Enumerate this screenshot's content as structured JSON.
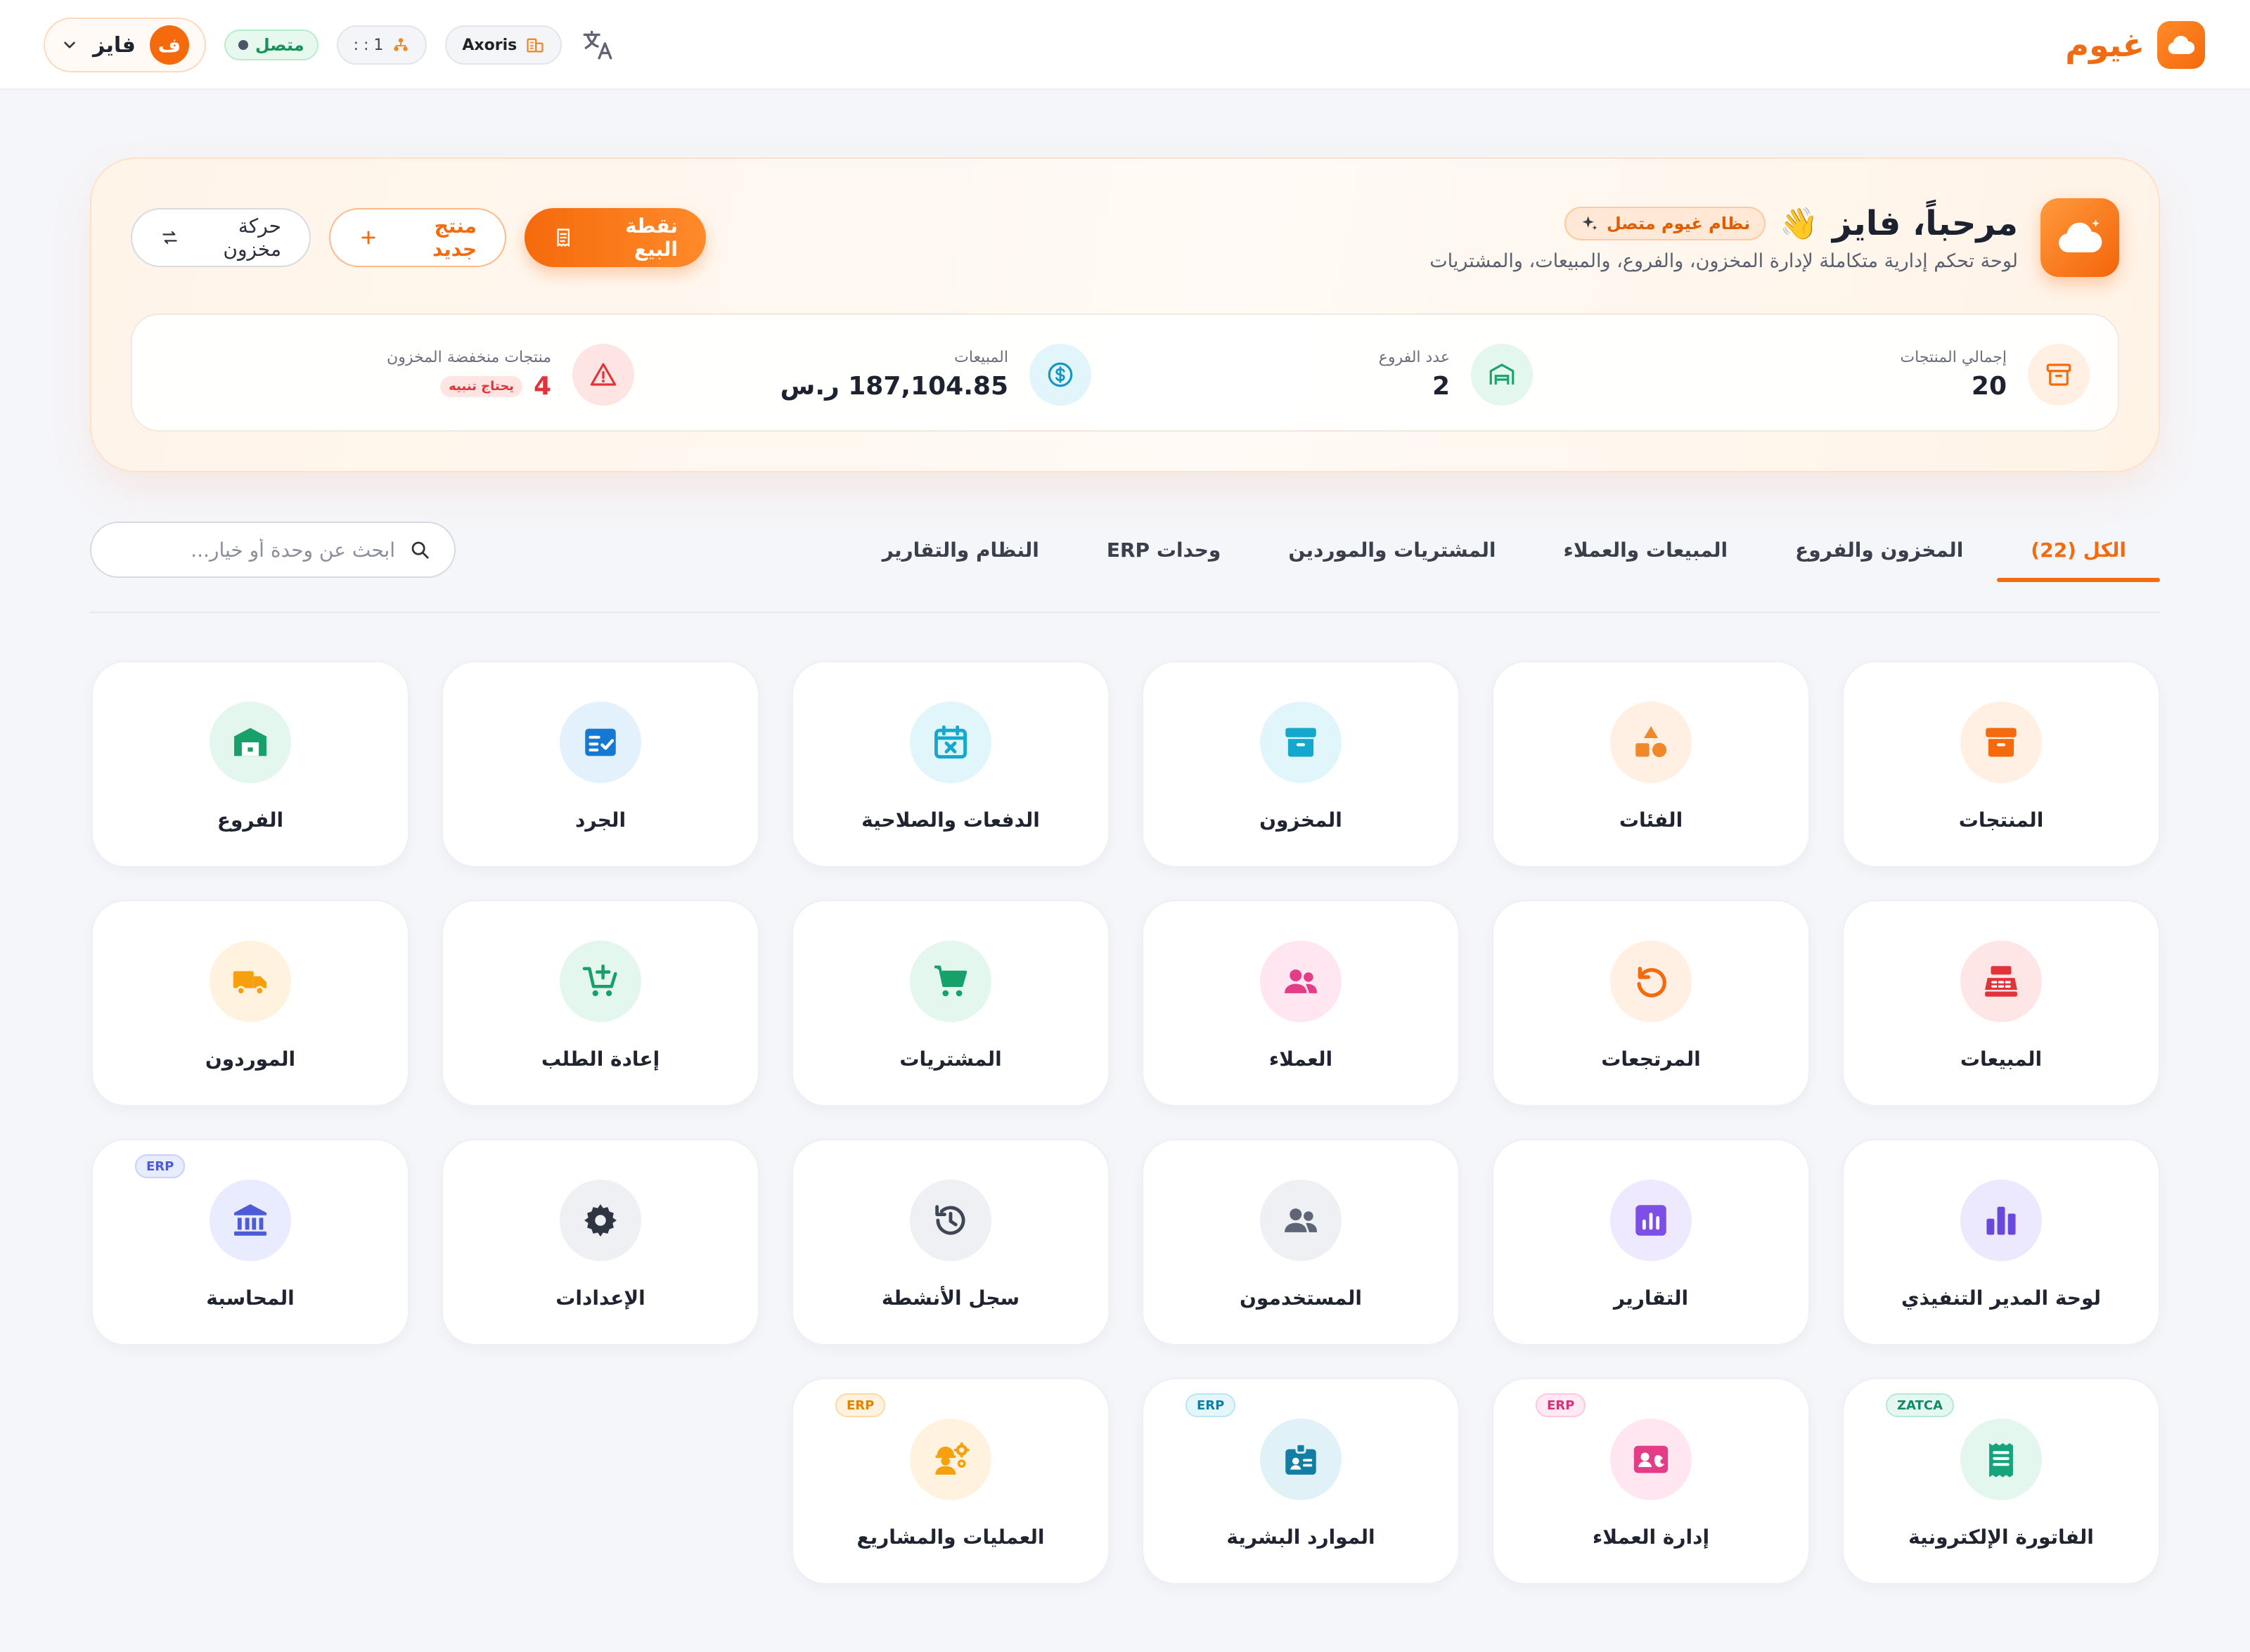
{
  "app": {
    "name": "غيوم",
    "user_initial": "ف",
    "user_name": "فايز",
    "status": "متصل",
    "shortcut": "1 : :",
    "company": "Axoris"
  },
  "hero": {
    "title": "مرحباً، فايز",
    "wave": "👋",
    "badge": "نظام غيوم متصل",
    "subtitle": "لوحة تحكم إدارية متكاملة لإدارة المخزون، والفروع، والمبيعات، والمشتريات",
    "actions": {
      "pos": "نقطة البيع",
      "new_product": "منتج جديد",
      "stock_move": "حركة مخزون"
    }
  },
  "stats": {
    "products": {
      "label": "إجمالي المنتجات",
      "value": "20"
    },
    "branches": {
      "label": "عدد الفروع",
      "value": "2"
    },
    "sales": {
      "label": "المبيعات",
      "value": "187,104.85 ر.س"
    },
    "low_stock": {
      "label": "منتجات منخفضة المخزون",
      "value": "4",
      "chip": "يحتاج تنبيه"
    }
  },
  "tabs": [
    {
      "label": "الكل (22)"
    },
    {
      "label": "المخزون والفروع"
    },
    {
      "label": "المبيعات والعملاء"
    },
    {
      "label": "المشتريات والموردين"
    },
    {
      "label": "وحدات ERP"
    },
    {
      "label": "النظام والتقارير"
    }
  ],
  "search": {
    "placeholder": "ابحث عن وحدة أو خيار..."
  },
  "modules": [
    {
      "label": "المنتجات",
      "tag": ""
    },
    {
      "label": "الفئات",
      "tag": ""
    },
    {
      "label": "المخزون",
      "tag": ""
    },
    {
      "label": "الدفعات والصلاحية",
      "tag": ""
    },
    {
      "label": "الجرد",
      "tag": ""
    },
    {
      "label": "الفروع",
      "tag": ""
    },
    {
      "label": "المبيعات",
      "tag": ""
    },
    {
      "label": "المرتجعات",
      "tag": ""
    },
    {
      "label": "العملاء",
      "tag": ""
    },
    {
      "label": "المشتريات",
      "tag": ""
    },
    {
      "label": "إعادة الطلب",
      "tag": ""
    },
    {
      "label": "الموردون",
      "tag": ""
    },
    {
      "label": "لوحة المدير التنفيذي",
      "tag": ""
    },
    {
      "label": "التقارير",
      "tag": ""
    },
    {
      "label": "المستخدمون",
      "tag": ""
    },
    {
      "label": "سجل الأنشطة",
      "tag": ""
    },
    {
      "label": "الإعدادات",
      "tag": ""
    },
    {
      "label": "المحاسبة",
      "tag": "ERP"
    },
    {
      "label": "الفاتورة الإلكترونية",
      "tag": "ZATCA"
    },
    {
      "label": "إدارة العملاء",
      "tag": "ERP"
    },
    {
      "label": "الموارد البشرية",
      "tag": "ERP"
    },
    {
      "label": "العمليات والمشاريع",
      "tag": "ERP"
    }
  ],
  "colors": {
    "accent": "#f56a0c",
    "success": "#16935a",
    "danger": "#e0333a"
  }
}
